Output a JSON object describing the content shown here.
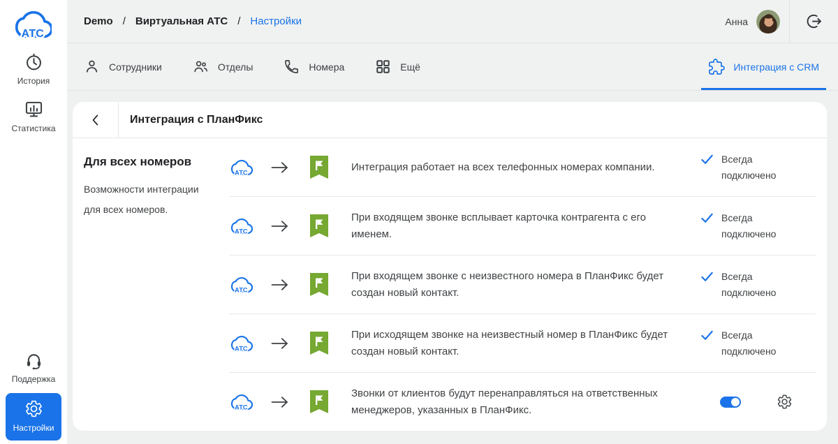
{
  "colors": {
    "accent_blue": "#1a73e8",
    "planfix_green": "#76a832",
    "page_background": "#eff1f0",
    "bar_background": "#f0f2f1",
    "card_background": "#ffffff",
    "text_dark": "#202124",
    "text_body": "#3f4245",
    "divider": "#e4e6e5"
  },
  "sidebar": {
    "logo_text": "АТС",
    "history_label": "История",
    "statistics_label": "Статистика",
    "support_label": "Поддержка",
    "settings_label": "Настройки"
  },
  "header": {
    "breadcrumb": {
      "root": "Demo",
      "middle": "Виртуальная АТС",
      "current": "Настройки",
      "separator": "/"
    },
    "user_name": "Анна"
  },
  "tabs": {
    "employees": "Сотрудники",
    "departments": "Отделы",
    "numbers": "Номера",
    "more": "Ещё",
    "crm": "Интеграция с CRM"
  },
  "panel": {
    "title": "Интеграция с ПланФикс",
    "section_heading": "Для всех номеров",
    "section_description": "Возможности интеграции для всех номеров.",
    "atc_icon_label": "АТС",
    "rows": [
      {
        "text": "Интеграция работает на всех телефонных номерах компании.",
        "status": "Всегда подключено"
      },
      {
        "text": "При входящем звонке всплывает карточка контрагента с его именем.",
        "status": "Всегда подключено"
      },
      {
        "text": "При входящем звонке с неизвестного номера в ПланФикс будет создан новый контакт.",
        "status": "Всегда подключено"
      },
      {
        "text": "При исходящем звонке на неизвестный номер в ПланФикс будет создан новый контакт.",
        "status": "Всегда подключено"
      },
      {
        "text": "Звонки от клиентов будут перенаправляться на ответственных менеджеров, указанных в ПланФикс.",
        "toggle_on": true
      }
    ]
  },
  "icons": {
    "logo": "cloud-atc",
    "history": "clock",
    "statistics": "bar-chart-monitor",
    "support": "headset",
    "settings": "gear",
    "employees": "person",
    "departments": "people",
    "numbers": "phone",
    "more": "grid",
    "crm": "puzzle",
    "back": "chevron-left",
    "flow_source": "cloud-atc",
    "flow_arrow": "arrow-right",
    "flow_target": "planfix-flag",
    "status": "check",
    "logout": "exit-arrow",
    "row_settings": "gear",
    "toggle": "switch-on"
  }
}
